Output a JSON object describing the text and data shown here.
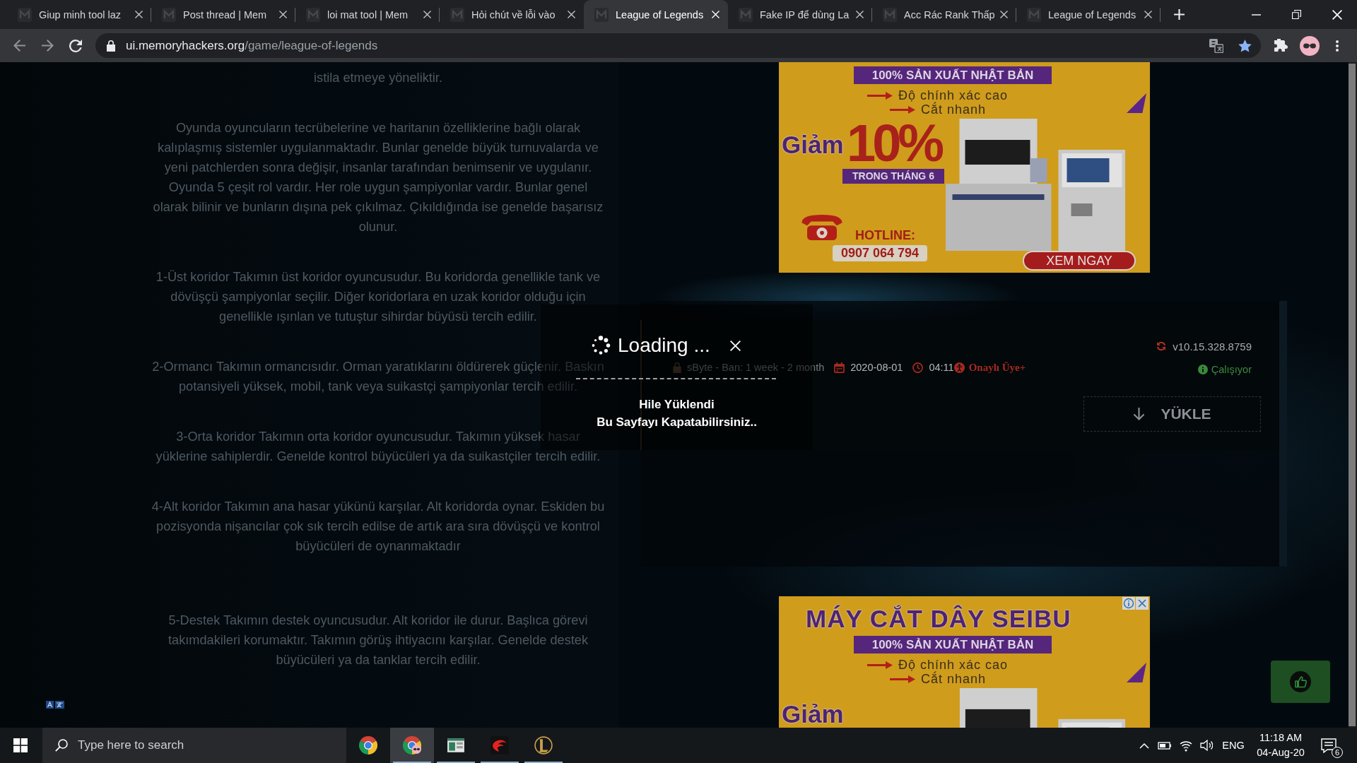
{
  "browser": {
    "tabs": [
      {
        "title": "Giup minh tool laz",
        "selected": false
      },
      {
        "title": "Post thread | Mem",
        "selected": false
      },
      {
        "title": "loi mat tool | Mem",
        "selected": false
      },
      {
        "title": "Hỏi chút về lỗi vào",
        "selected": false
      },
      {
        "title": "League of Legends",
        "selected": true
      },
      {
        "title": "Fake IP để dùng La",
        "selected": false
      },
      {
        "title": "Acc Rác Rank Thấp",
        "selected": false
      },
      {
        "title": "League of Legends",
        "selected": false
      }
    ],
    "address_bar": {
      "domain": "ui.memoryhackers.org",
      "path": "/game/league-of-legends",
      "bookmarked": true
    }
  },
  "article": {
    "paragraphs": [
      "istila etmeye yöneliktir.",
      "Oyunda oyuncuların tecrübelerine ve haritanın özelliklerine bağlı olarak kalıplaşmış sistemler uygulanmaktadır. Bunlar genelde büyük turnuvalarda ve yeni patchlerden sonra değişir, insanlar tarafından benimsenir ve uygulanır. Oyunda 5 çeşit rol vardır. Her role uygun şampiyonlar vardır. Bunlar genel olarak bilinir ve bunların dışına pek çıkılmaz. Çıkıldığında ise genelde başarısız olunur.",
      "1-Üst koridor Takımın üst koridor oyuncusudur. Bu koridorda genellikle tank ve dövüşçü şampiyonlar seçilir. Diğer koridorlara en uzak koridor olduğu için genellikle ışınlan ve tutuştur sihirdar büyüsü tercih edilir.",
      "2-Ormancı Takımın ormancısıdır. Orman yaratıklarını öldürerek güçlenir. Baskın potansiyeli yüksek, mobil, tank veya suikastçi şampiyonlar tercih edilir.",
      "3-Orta koridor Takımın orta koridor oyuncusudur. Takımın yüksek hasar yüklerine sahiplerdir. Genelde kontrol büyücüleri ya da suikastçiler tercih edilir.",
      "4-Alt koridor Takımın ana hasar yükünü karşılar. Alt koridorda oynar. Eskiden bu pozisyonda nişancılar çok sık tercih edilse de artık ara sıra dövüşçü ve kontrol büyücüleri de oynanmaktadır",
      "5-Destek Takımın destek oyuncusudur. Alt koridor ile durur. Başlıca görevi takımdakileri korumaktır. Takımın görüş ihtiyacını karşılar. Genelde destek büyücüleri ya da tanklar tercih edilir."
    ]
  },
  "ads": [
    {
      "closable": false,
      "tagline": "100% SẢN XUẤT NHẬT BẢN",
      "features": [
        "Độ chính xác cao",
        "Cắt nhanh"
      ],
      "discount_word": "Giảm",
      "discount": "10%",
      "period": "TRONG THÁNG 6",
      "hotline_label": "HOTLINE:",
      "hotline": "0907 064 794",
      "cta": "XEM NGAY"
    },
    {
      "closable": true,
      "headline": "MÁY CẮT DÂY SEIBU",
      "tagline": "100% SẢN XUẤT NHẬT BẢN",
      "features": [
        "Độ chính xác cao",
        "Cắt nhanh"
      ],
      "discount_word": "Giảm"
    }
  ],
  "cheat_card": {
    "author": "sByte - Ban: 1 week - 2 month",
    "date": "2020-08-01",
    "time": "04:11",
    "badge": "Onaylı Üye+",
    "version": "v10.15.328.8759",
    "status": "Çalışıyor",
    "download_button": "YÜKLE"
  },
  "loading_dialog": {
    "title": "Loading ...",
    "message_lines": [
      "Hile Yüklendi",
      "Bu Sayfayı Kapatabilirsiniz.."
    ]
  },
  "taskbar": {
    "search_placeholder": "Type here to search",
    "apps": [
      {
        "kind": "browser",
        "selected": false,
        "running": false
      },
      {
        "kind": "profile",
        "selected": true,
        "running": true
      },
      {
        "kind": "window",
        "selected": false,
        "running": true
      },
      {
        "kind": "emblem",
        "selected": false,
        "running": true
      },
      {
        "kind": "crest",
        "selected": false,
        "running": true
      }
    ],
    "language": "ENG",
    "time": "11:18 AM",
    "date": "04-Aug-20",
    "notification_count": "6"
  }
}
